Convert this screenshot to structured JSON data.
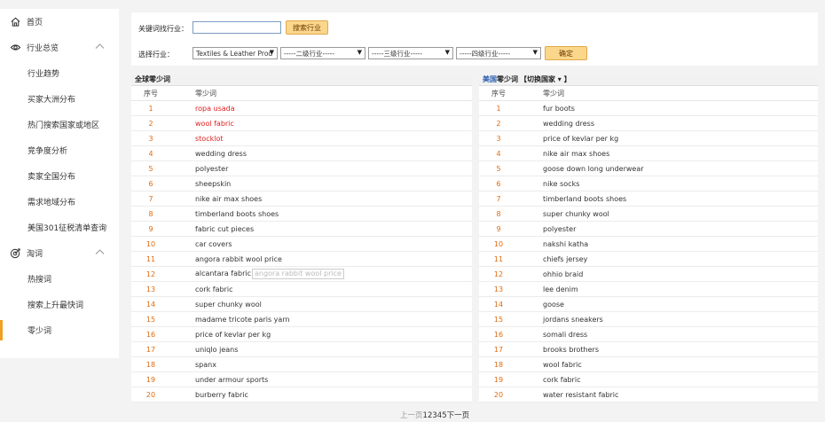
{
  "sidebar": {
    "home": "首页",
    "industry_group": "行业总览",
    "industry_items": [
      "行业趋势",
      "买家大洲分布",
      "热门搜索国家或地区",
      "竞争度分析",
      "卖家全国分布",
      "需求地域分布",
      "美国301征税清单查询"
    ],
    "taoci_group": "淘词",
    "taoci_items": [
      "热搜词",
      "搜索上升最快词",
      "零少词"
    ]
  },
  "filter": {
    "keyword_label": "关键词找行业：",
    "keyword_value": "",
    "search_button": "搜索行业",
    "industry_label": "选择行业：",
    "select1": "Textiles & Leather Prod",
    "select2": "-----二级行业-----",
    "select3": "-----三级行业-----",
    "select4": "-----四级行业-----",
    "confirm_button": "确定"
  },
  "global_table": {
    "title": "全球零少词",
    "col_no": "序号",
    "col_kw": "零少词",
    "tooltip": "angora rabbit wool price",
    "rows": [
      {
        "no": "1",
        "kw": "ropa usada"
      },
      {
        "no": "2",
        "kw": "wool fabric"
      },
      {
        "no": "3",
        "kw": "stocklot"
      },
      {
        "no": "4",
        "kw": "wedding dress"
      },
      {
        "no": "5",
        "kw": "polyester"
      },
      {
        "no": "6",
        "kw": "sheepskin"
      },
      {
        "no": "7",
        "kw": "nike air max shoes"
      },
      {
        "no": "8",
        "kw": "timberland boots shoes"
      },
      {
        "no": "9",
        "kw": "fabric cut pieces"
      },
      {
        "no": "10",
        "kw": "car covers"
      },
      {
        "no": "11",
        "kw": "angora rabbit wool price"
      },
      {
        "no": "12",
        "kw": "alcantara fabric"
      },
      {
        "no": "13",
        "kw": "cork fabric"
      },
      {
        "no": "14",
        "kw": "super chunky wool"
      },
      {
        "no": "15",
        "kw": "madame tricote paris yarn"
      },
      {
        "no": "16",
        "kw": "price of kevlar per kg"
      },
      {
        "no": "17",
        "kw": "uniqlo jeans"
      },
      {
        "no": "18",
        "kw": "spanx"
      },
      {
        "no": "19",
        "kw": "under armour sports"
      },
      {
        "no": "20",
        "kw": "burberry fabric"
      }
    ]
  },
  "us_table": {
    "title_country": "美国",
    "title_rest": "零少词",
    "switch": "【切换国家 ▾ 】",
    "col_no": "序号",
    "col_kw": "零少词",
    "rows": [
      {
        "no": "1",
        "kw": "fur boots"
      },
      {
        "no": "2",
        "kw": "wedding dress"
      },
      {
        "no": "3",
        "kw": "price of kevlar per kg"
      },
      {
        "no": "4",
        "kw": "nike air max shoes"
      },
      {
        "no": "5",
        "kw": "goose down long underwear"
      },
      {
        "no": "6",
        "kw": "nike socks"
      },
      {
        "no": "7",
        "kw": "timberland boots shoes"
      },
      {
        "no": "8",
        "kw": "super chunky wool"
      },
      {
        "no": "9",
        "kw": "polyester"
      },
      {
        "no": "10",
        "kw": "nakshi katha"
      },
      {
        "no": "11",
        "kw": "chiefs jersey"
      },
      {
        "no": "12",
        "kw": "ohhio braid"
      },
      {
        "no": "13",
        "kw": "lee denim"
      },
      {
        "no": "14",
        "kw": "goose"
      },
      {
        "no": "15",
        "kw": "jordans sneakers"
      },
      {
        "no": "16",
        "kw": "somali dress"
      },
      {
        "no": "17",
        "kw": "brooks brothers"
      },
      {
        "no": "18",
        "kw": "wool fabric"
      },
      {
        "no": "19",
        "kw": "cork fabric"
      },
      {
        "no": "20",
        "kw": "water resistant fabric"
      }
    ]
  },
  "pager": {
    "prev": "上一页",
    "pages": [
      "1",
      "2",
      "3",
      "4",
      "5"
    ],
    "next": "下一页"
  },
  "icons": {
    "home": "home-icon",
    "industry": "eye-icon",
    "taoci": "target-icon",
    "accent": "#f0a020"
  }
}
